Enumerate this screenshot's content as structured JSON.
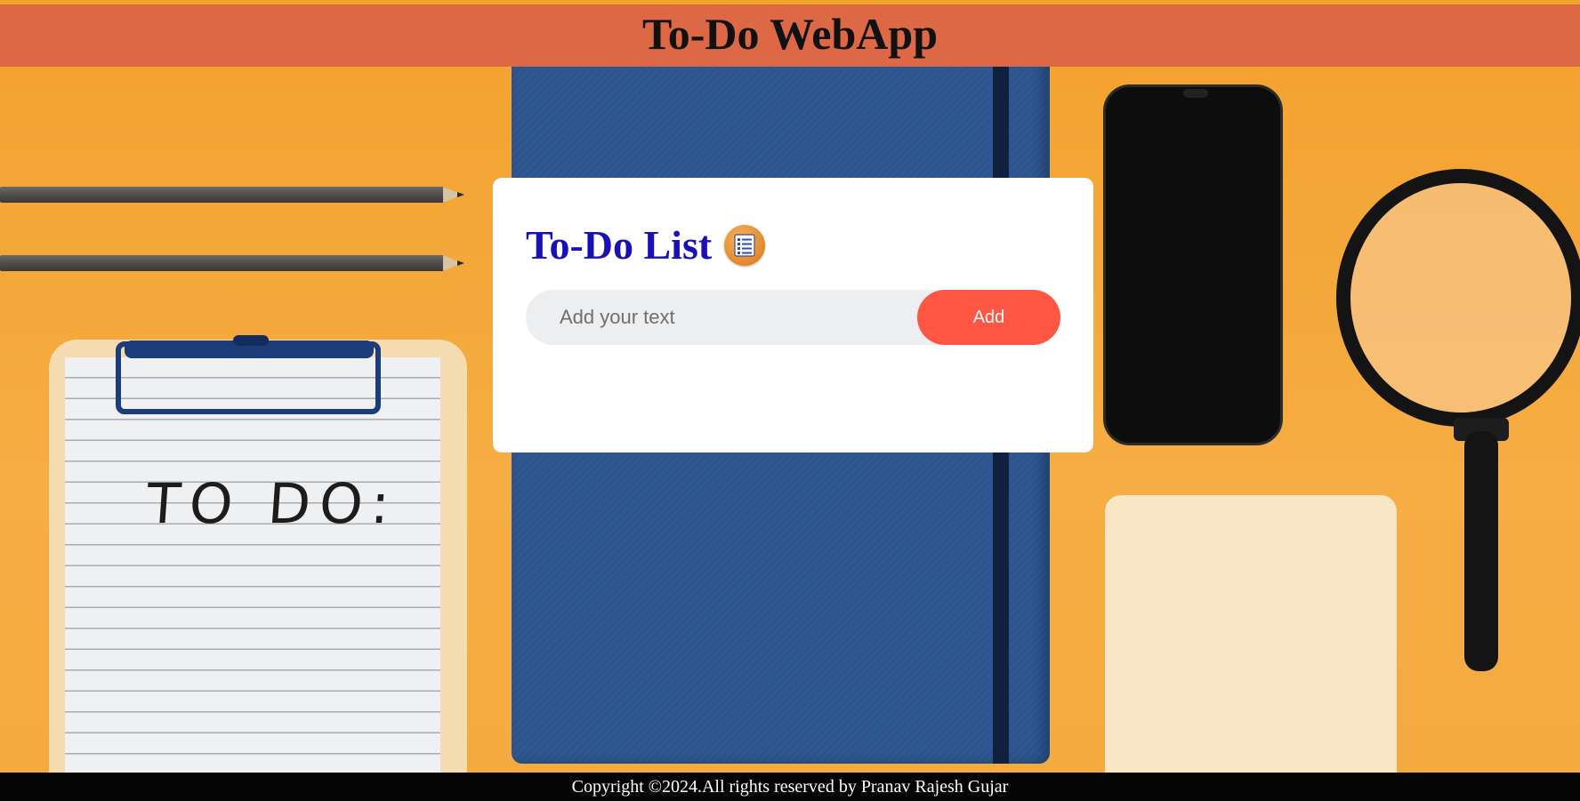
{
  "header": {
    "title": "To-Do WebApp"
  },
  "card": {
    "title": "To-Do List",
    "icon": "checklist-icon",
    "input": {
      "placeholder": "Add your text",
      "value": ""
    },
    "add_label": "Add"
  },
  "background": {
    "handwriting": "TO DO:"
  },
  "footer": {
    "copyright": "Copyright ©2024.All rights reserved by Pranav Rajesh Gujar"
  },
  "colors": {
    "header_bg": "#dc6845",
    "title_color": "#1a10b8",
    "button_bg": "#fd5643",
    "footer_bg": "#050505"
  }
}
